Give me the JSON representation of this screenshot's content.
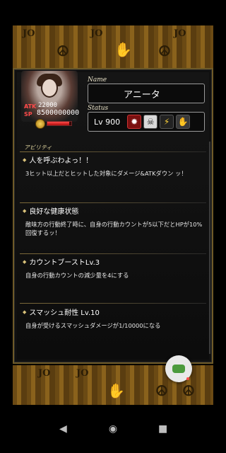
{
  "colors": {
    "accent_gold": "#d9c27a",
    "hp_red": "#e02525",
    "panel_border": "#6e5a28"
  },
  "background": {
    "top_symbols": [
      "JO",
      "☮",
      "JO",
      "✋",
      "JO",
      "☮"
    ],
    "bottom_symbols": [
      "JO",
      "✋",
      "☮",
      "JO",
      "☮"
    ]
  },
  "character": {
    "atk_label": "ATK",
    "sp_label": "SP",
    "atk_value": "22000",
    "sp_value": "8500000000",
    "hp_fraction": 0.9
  },
  "name_section": {
    "label": "Name",
    "value": "アニータ"
  },
  "status_section": {
    "label": "Status",
    "lv_prefix": "Lv",
    "level": "900",
    "icons": [
      "gear-icon",
      "skull-icon",
      "lightning-icon",
      "hand-icon"
    ]
  },
  "ability_tag": "アビリティ",
  "skills": [
    {
      "title": "人を呼ぶわよっ！！",
      "desc": "3ヒット以上だとヒットした対象にダメージ&ATKダウン ッ！"
    },
    {
      "title": "良好な健康状態",
      "desc": "敵味方の行動終了時に、自身の行動カウントが5以下だとHPが10%回復するッ！"
    },
    {
      "title": "カウントブーストLv.3",
      "desc": "自身の行動カウントの減少量を4にする"
    },
    {
      "title": "スマッシュ耐性 Lv.10",
      "desc": "自身が受けるスマッシュダメージが1/10000になる"
    }
  ],
  "nav": {
    "back": "◀",
    "home": "◉",
    "recent": "■"
  }
}
